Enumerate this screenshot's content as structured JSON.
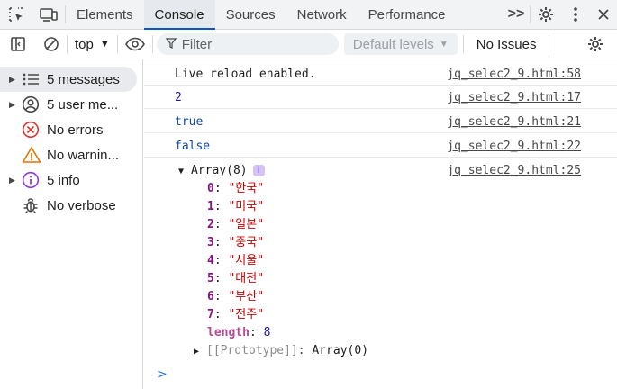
{
  "tabbar": {
    "tabs": [
      {
        "label": "Elements"
      },
      {
        "label": "Console"
      },
      {
        "label": "Sources"
      },
      {
        "label": "Network"
      },
      {
        "label": "Performance"
      }
    ],
    "active_tab": "Console",
    "more_label": ">>"
  },
  "toolbar": {
    "context": "top",
    "filter_placeholder": "Filter",
    "levels_label": "Default levels",
    "issues_label": "No Issues"
  },
  "sidebar": {
    "items": [
      {
        "label": "5 messages",
        "icon": "list-icon",
        "expandable": true,
        "selected": true
      },
      {
        "label": "5 user me...",
        "icon": "user-icon",
        "expandable": true,
        "selected": false
      },
      {
        "label": "No errors",
        "icon": "error-icon",
        "expandable": false,
        "selected": false
      },
      {
        "label": "No warnin...",
        "icon": "warning-icon",
        "expandable": false,
        "selected": false
      },
      {
        "label": "5 info",
        "icon": "info-icon",
        "expandable": true,
        "selected": false
      },
      {
        "label": "No verbose",
        "icon": "bug-icon",
        "expandable": false,
        "selected": false
      }
    ]
  },
  "console": {
    "messages": [
      {
        "text": "Live reload enabled.",
        "source": "jq_selec2_9.html:58"
      },
      {
        "text": "2",
        "source": "jq_selec2_9.html:17"
      },
      {
        "text": "true",
        "source": "jq_selec2_9.html:21"
      },
      {
        "text": "false",
        "source": "jq_selec2_9.html:22"
      }
    ],
    "array": {
      "header": "Array(8)",
      "source": "jq_selec2_9.html:25",
      "items": [
        {
          "key": "0",
          "value": "\"한국\""
        },
        {
          "key": "1",
          "value": "\"미국\""
        },
        {
          "key": "2",
          "value": "\"일본\""
        },
        {
          "key": "3",
          "value": "\"중국\""
        },
        {
          "key": "4",
          "value": "\"서울\""
        },
        {
          "key": "5",
          "value": "\"대전\""
        },
        {
          "key": "6",
          "value": "\"부산\""
        },
        {
          "key": "7",
          "value": "\"전주\""
        }
      ],
      "length_key": "length",
      "length_value": "8",
      "prototype_key": "[[Prototype]]",
      "prototype_value": "Array(0)"
    },
    "prompt": ">"
  },
  "colors": {
    "accent": "#0b57d0",
    "error": "#dc362e",
    "warning": "#e37400",
    "info": "#9334e6",
    "string": "#c80000",
    "key": "#881280"
  }
}
